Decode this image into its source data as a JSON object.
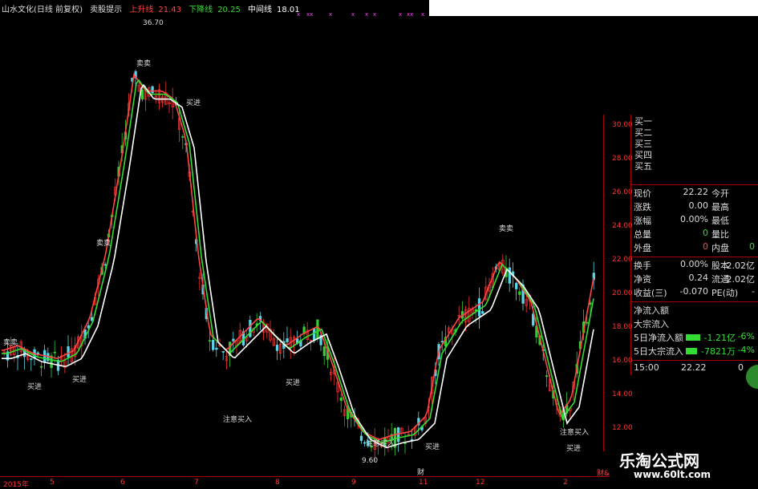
{
  "header": {
    "stock_name": "山水文化(日线 前复权)",
    "indicator": "卖股提示",
    "up_label": "上升线",
    "up_value": "21.43",
    "down_label": "下降线",
    "down_value": "20.25",
    "mid_label": "中间线",
    "mid_value": "18.01",
    "marks": [
      "x",
      "xx",
      "x",
      "x",
      "x",
      "x",
      "x",
      "xx",
      "x"
    ]
  },
  "price_axis": [
    "30.00",
    "28.00",
    "26.00",
    "24.00",
    "22.00",
    "20.00",
    "18.00",
    "16.00",
    "14.00",
    "12.00"
  ],
  "x_axis": [
    "2015年",
    "5",
    "6",
    "7",
    "8",
    "9",
    "11",
    "12",
    "2"
  ],
  "annotations": {
    "high": "36.70",
    "low": "9.60",
    "sell": "卖卖",
    "buy": "买进",
    "attention_buy": "注意买入",
    "finance": "财",
    "fv": "财&"
  },
  "quote_panel": {
    "bids": [
      "买一",
      "买二",
      "买三",
      "买四",
      "买五"
    ],
    "rows": [
      {
        "l": "现价",
        "v": "22.22",
        "l2": "今开",
        "v2": ""
      },
      {
        "l": "涨跌",
        "v": "0.00",
        "l2": "最高",
        "v2": ""
      },
      {
        "l": "涨幅",
        "v": "0.00%",
        "l2": "最低",
        "v2": ""
      },
      {
        "l": "总量",
        "v": "0",
        "l2": "量比",
        "v2": ""
      },
      {
        "l": "外盘",
        "v": "0",
        "l2": "内盘",
        "v2": "0"
      },
      {
        "l": "换手",
        "v": "0.00%",
        "l2": "股本",
        "v2": "2.02亿"
      },
      {
        "l": "净资",
        "v": "0.24",
        "l2": "流通",
        "v2": "2.02亿"
      },
      {
        "l": "收益(三)",
        "v": "-0.070",
        "l2": "PE(动)",
        "v2": "-"
      }
    ],
    "flow": [
      {
        "l": "净流入额",
        "v": "",
        "p": ""
      },
      {
        "l": "大宗流入",
        "v": "",
        "p": ""
      },
      {
        "l": "5日净流入额",
        "v": "-1.21亿",
        "p": "-6%"
      },
      {
        "l": "5日大宗流入",
        "v": "-7821万",
        "p": "-4%"
      }
    ],
    "time": "15:00",
    "time_price": "22.22",
    "time_vol": "0"
  },
  "logo": {
    "name": "乐淘公式网",
    "url": "www.60lt.com"
  },
  "colors": {
    "up": "#ff4444",
    "down": "#33dd33",
    "mid": "#ffffff"
  }
}
